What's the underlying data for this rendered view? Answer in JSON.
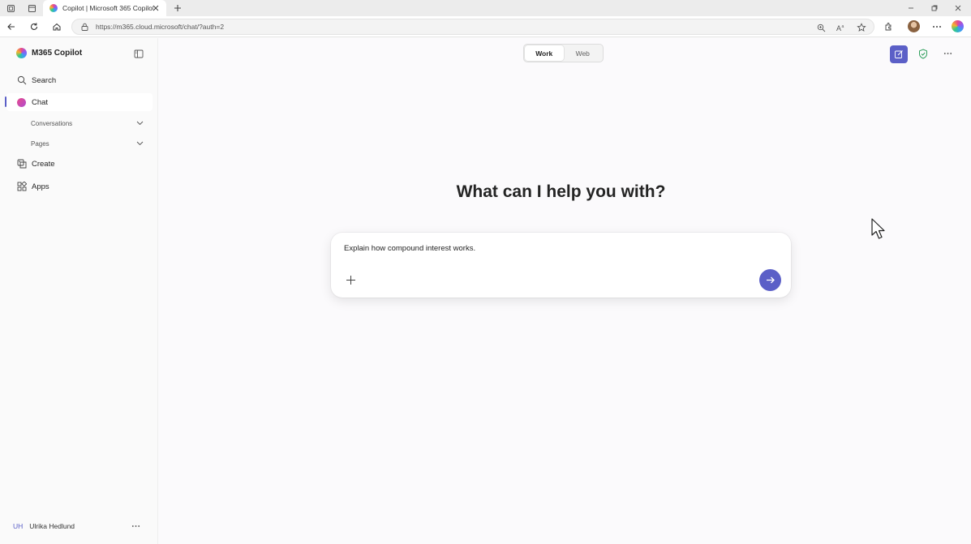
{
  "browser": {
    "tab_title": "Copilot | Microsoft 365 Copilot",
    "url": "https://m365.cloud.microsoft/chat/?auth=2"
  },
  "sidebar": {
    "app_name": "M365 Copilot",
    "items": [
      {
        "label": "Search",
        "icon": "search-icon"
      },
      {
        "label": "Chat",
        "icon": "chat-icon",
        "active": true
      },
      {
        "label": "Create",
        "icon": "create-icon"
      },
      {
        "label": "Apps",
        "icon": "apps-icon"
      }
    ],
    "subitems": [
      {
        "label": "Conversations"
      },
      {
        "label": "Pages"
      }
    ],
    "user": {
      "initials": "UH",
      "name": "Ulrika Hedlund"
    }
  },
  "main": {
    "toggle": {
      "work_label": "Work",
      "web_label": "Web",
      "selected": "Work"
    },
    "heading": "What can I help you with?",
    "composer": {
      "value": "Explain how compound interest works."
    }
  },
  "colors": {
    "accent": "#5b5fc7",
    "shield": "#2e9e5b"
  }
}
